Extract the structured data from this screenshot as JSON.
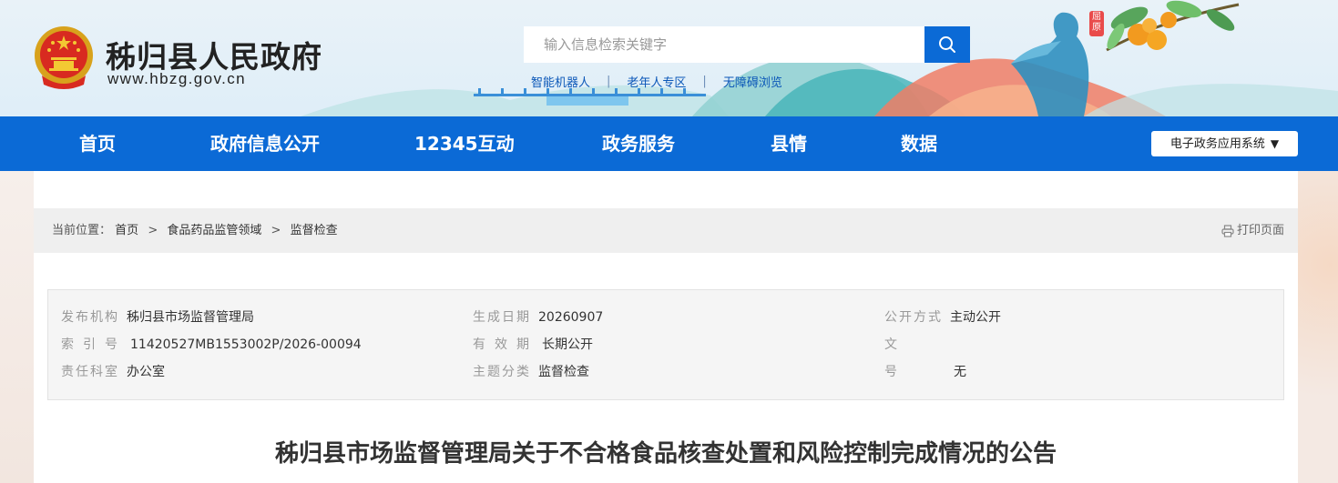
{
  "header": {
    "site_title": "秭归县人民政府",
    "site_url": "www.hbzg.gov.cn",
    "search_placeholder": "输入信息检索关键字",
    "quick_links": [
      "智能机器人",
      "老年人专区",
      "无障碍浏览"
    ],
    "badge_text": "屈原",
    "brand_color": "#0b6ad6"
  },
  "nav": {
    "items": [
      "首页",
      "政府信息公开",
      "12345互动",
      "政务服务",
      "县情",
      "数据"
    ],
    "dropdown_label": "电子政务应用系统",
    "dropdown_caret": "▼"
  },
  "breadcrumb": {
    "label": "当前位置：",
    "items": [
      "首页",
      "食品药品监管领域",
      "监督检查"
    ],
    "separator": ">"
  },
  "print_label": "打印页面",
  "meta": {
    "rows": [
      [
        {
          "key": "发布机构",
          "value": "秭归县市场监督管理局"
        },
        {
          "key": "生成日期",
          "value": "20260907"
        },
        {
          "key": "公开方式",
          "value": "主动公开"
        }
      ],
      [
        {
          "key": "索引号",
          "value": "11420527MB1553002P/2026-00094"
        },
        {
          "key": "有效期",
          "value": "长期公开"
        },
        {
          "key": "文号",
          "value": "无"
        }
      ],
      [
        {
          "key": "责任科室",
          "value": "办公室"
        },
        {
          "key": "主题分类",
          "value": "监督检查"
        }
      ]
    ]
  },
  "article": {
    "title": "秭归县市场监督管理局关于不合格食品核查处置和风险控制完成情况的公告"
  }
}
